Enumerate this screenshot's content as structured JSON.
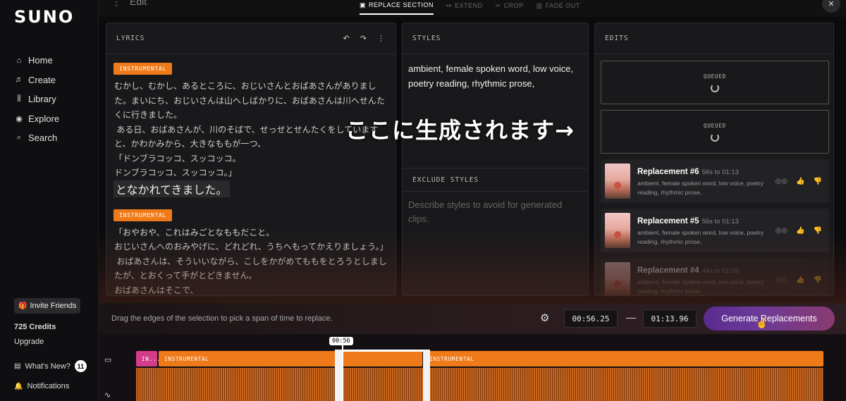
{
  "app": {
    "logo": "SUNO"
  },
  "sidebar": {
    "items": [
      {
        "icon": "home-icon",
        "glyph": "⌂",
        "label": "Home"
      },
      {
        "icon": "music-note-icon",
        "glyph": "♬",
        "label": "Create"
      },
      {
        "icon": "library-icon",
        "glyph": "⫼",
        "label": "Library"
      },
      {
        "icon": "compass-icon",
        "glyph": "◉",
        "label": "Explore"
      },
      {
        "icon": "search-icon",
        "glyph": "⌕",
        "label": "Search"
      }
    ],
    "invite_label": "Invite Friends",
    "credits": "725 Credits",
    "upgrade": "Upgrade",
    "whats_new": "What's New?",
    "whats_new_count": "11",
    "notifications": "Notifications"
  },
  "topbar": {
    "title": "Edit",
    "tabs": [
      {
        "label": "REPLACE SECTION",
        "active": true
      },
      {
        "label": "EXTEND",
        "active": false
      },
      {
        "label": "CROP",
        "active": false
      },
      {
        "label": "FADE OUT",
        "active": false
      }
    ],
    "close": "✕"
  },
  "lyrics": {
    "header": "LYRICS",
    "tag1": "INSTRUMENTAL",
    "text1": "むかし、むかし、あるところに、おじいさんとおばあさんがありました。まいにち、おじいさんは山へしばかりに、おばあさんは川へせんたくに行きました。\n ある日、おばあさんが、川のそばで、せっせとせんたくをしていますと、かわかみから、大きなももが一つ、\n「ドンブラコッコ、スッコッコ。\nドンブラコッコ、スッコッコ。」",
    "highlight": "となかれてきました。",
    "tag2": "INSTRUMENTAL",
    "text2": "「おやおや、これはみごとなももだこと。\nおじいさんへのおみやげに、どれどれ、うちへもってかえりましょう。」\n おばあさんは、そういいながら、こしをかがめてももをとろうとしましたが、とおくって手がとどきません。\nおばあさんはそこで、\n「アッチノミイズ ワ、カアライゾ。"
  },
  "styles": {
    "header": "STYLES",
    "value": "ambient, female spoken word, low voice, poetry reading, rhythmic prose,",
    "exclude_header": "EXCLUDE STYLES",
    "exclude_placeholder": "Describe styles to avoid for generated clips."
  },
  "edits": {
    "header": "EDITS",
    "queued_label": "QUEUED",
    "replacements": [
      {
        "title": "Replacement #6",
        "time": "56s to 01:13",
        "desc": "ambient, female spoken word, low voice, poetry reading, rhythmic prose,"
      },
      {
        "title": "Replacement #5",
        "time": "56s to 01:13",
        "desc": "ambient, female spoken word, low voice, poetry reading, rhythmic prose,"
      },
      {
        "title": "Replacement #4",
        "time": "44s to 01:03",
        "desc": "ambient, female spoken word, low voice, poetry reading, rhythmic prose,"
      }
    ]
  },
  "overlay_text": "ここに生成されます→",
  "controls": {
    "hint": "Drag the edges of the selection to pick a span of time to replace.",
    "start_time": "00:56.25",
    "separator": "—",
    "end_time": "01:13.96",
    "generate_label": "Generate Replacements"
  },
  "timeline": {
    "playhead_label": "00:56",
    "seg_intro": "IN...",
    "seg_a": "INSTRUMENTAL",
    "seg_b": "INSTRUMENTAL"
  },
  "colors": {
    "accent_orange": "#ef7a1a",
    "intro_pink": "#d43b8a",
    "button_purple": "#6b3a98"
  }
}
